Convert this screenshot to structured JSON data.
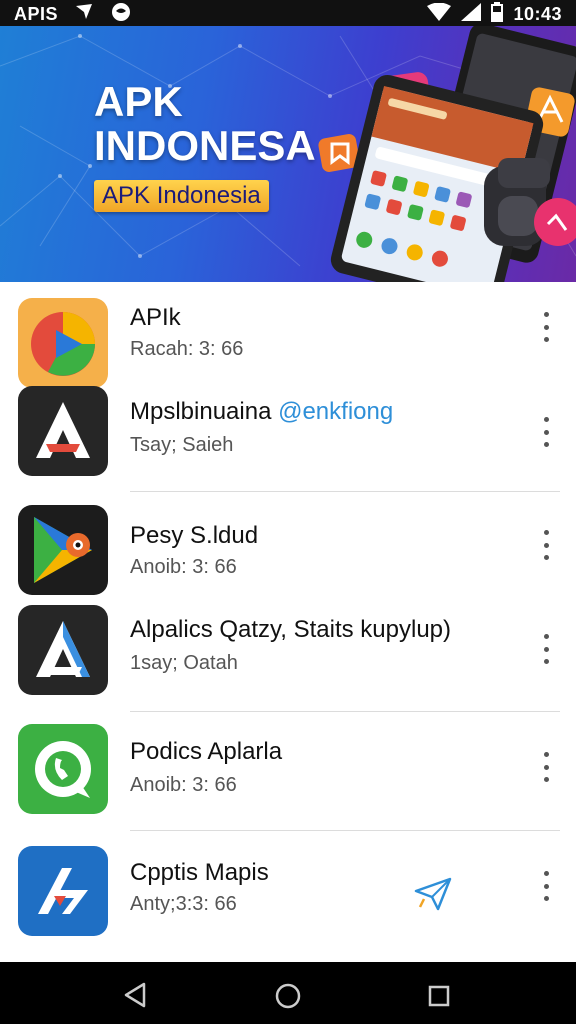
{
  "status_bar": {
    "carrier": "APIS",
    "time": "10:43"
  },
  "banner": {
    "title_line1": "APK",
    "title_line2": "INDONESA",
    "subtitle": "APK Indonesia"
  },
  "apps": [
    {
      "name": "APIk",
      "handle": "",
      "meta": "Racah: 3: 66",
      "icon": "chrome-play-icon",
      "bg": "#f5b04a"
    },
    {
      "name": "Mpslbinuaina ",
      "handle": "@enkfiong",
      "meta": "Tsay; Saieh",
      "icon": "aptoide-icon",
      "bg": "#262626"
    },
    {
      "name": "Pesy S.ldud",
      "handle": "",
      "meta": "Anoib: 3: 66",
      "icon": "play-store-icon",
      "bg": "#1c1c1c"
    },
    {
      "name": "Alpalics Qatzy, Staits kupylup)",
      "handle": "",
      "meta": "1say; Oatah",
      "icon": "aptoide-icon",
      "bg": "#262626"
    },
    {
      "name": "Podics Aplarla",
      "handle": "",
      "meta": "Anoib: 3: 66",
      "icon": "phone-chat-icon",
      "bg": "#3cb043"
    },
    {
      "name": "Cpptis Mapis",
      "handle": "",
      "meta": "Anty;3:3: 66",
      "icon": "apkpure-icon",
      "bg": "#1f6fc4"
    }
  ]
}
